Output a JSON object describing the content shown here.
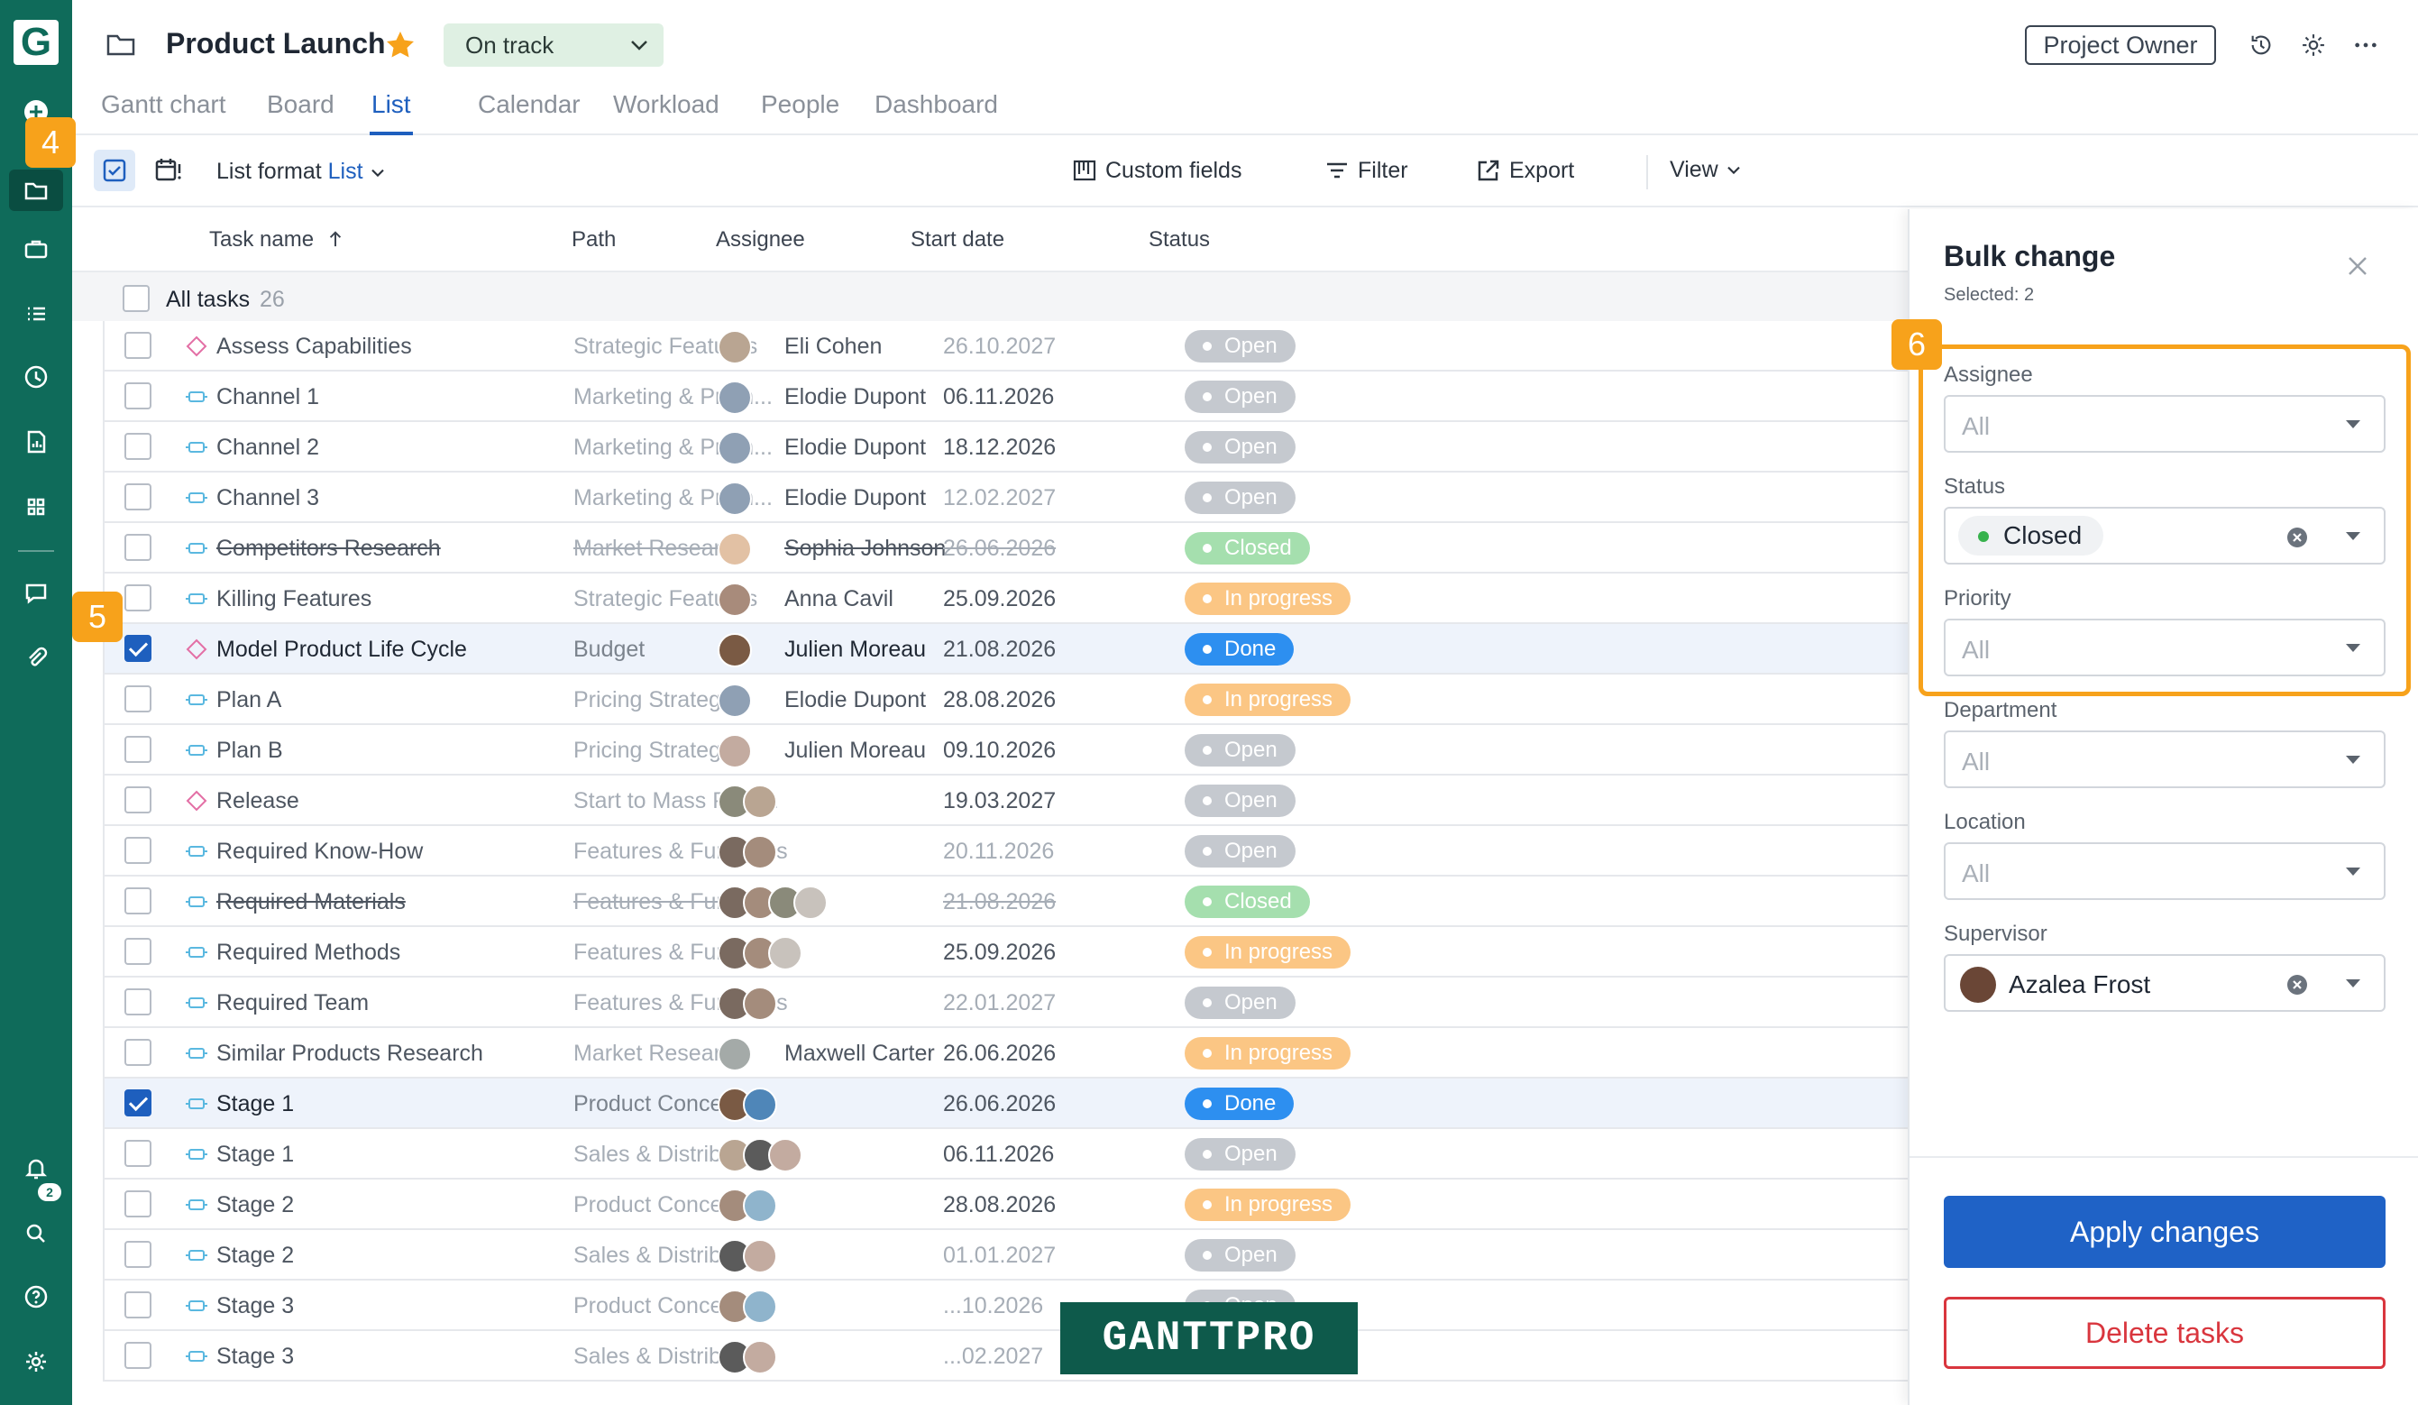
{
  "header": {
    "project_title": "Product Launch",
    "status": "On track",
    "role": "Project Owner",
    "tabs": [
      "Gantt chart",
      "Board",
      "List",
      "Calendar",
      "Workload",
      "People",
      "Dashboard"
    ],
    "active_tab": "List"
  },
  "toolbar": {
    "list_format_label": "List format",
    "list_format_value": "List",
    "custom_fields": "Custom fields",
    "filter": "Filter",
    "export": "Export",
    "view": "View"
  },
  "table": {
    "columns": [
      "Task name",
      "Path",
      "Assignee",
      "Start date",
      "Status"
    ],
    "all_tasks_label": "All tasks",
    "all_tasks_count": "26",
    "rows": [
      {
        "name": "Assess Capabilities",
        "icon": "milestone-icon",
        "path": "Strategic Features",
        "assignee": "Eli Cohen",
        "avatars": [
          "#b9a592"
        ],
        "date": "26.10.2027",
        "status": "Open",
        "checked": false,
        "strike": false
      },
      {
        "name": "Channel 1",
        "icon": "task-icon",
        "path": "Marketing & Prom...",
        "assignee": "Elodie Dupont",
        "avatars": [
          "#8fa0b4"
        ],
        "date": "06.11.2026",
        "status": "Open",
        "checked": false,
        "strike": false
      },
      {
        "name": "Channel 2",
        "icon": "task-icon",
        "path": "Marketing & Prom...",
        "assignee": "Elodie Dupont",
        "avatars": [
          "#8fa0b4"
        ],
        "date": "18.12.2026",
        "status": "Open",
        "checked": false,
        "strike": false
      },
      {
        "name": "Channel 3",
        "icon": "task-icon",
        "path": "Marketing & Prom...",
        "assignee": "Elodie Dupont",
        "avatars": [
          "#8fa0b4"
        ],
        "date": "12.02.2027",
        "status": "Open",
        "checked": false,
        "strike": false
      },
      {
        "name": "Competitors Research",
        "icon": "task-icon",
        "path": "Market Research",
        "assignee": "Sophia Johnson",
        "avatars": [
          "#e2c1a4"
        ],
        "date": "26.06.2026",
        "status": "Closed",
        "checked": false,
        "strike": true
      },
      {
        "name": "Killing Features",
        "icon": "task-icon",
        "path": "Strategic Features",
        "assignee": "Anna Cavil",
        "avatars": [
          "#a88b7b"
        ],
        "date": "25.09.2026",
        "status": "In progress",
        "checked": false,
        "strike": false
      },
      {
        "name": "Model Product Life Cycle",
        "icon": "milestone-icon",
        "path": "Budget",
        "assignee": "Julien Moreau",
        "avatars": [
          "#7a5a44"
        ],
        "date": "21.08.2026",
        "status": "Done",
        "checked": true,
        "strike": false
      },
      {
        "name": "Plan A",
        "icon": "task-icon",
        "path": "Pricing Strategy",
        "assignee": "Elodie Dupont",
        "avatars": [
          "#8fa0b4"
        ],
        "date": "28.08.2026",
        "status": "In progress",
        "checked": false,
        "strike": false
      },
      {
        "name": "Plan B",
        "icon": "task-icon",
        "path": "Pricing Strategy",
        "assignee": "Julien Moreau",
        "avatars": [
          "#c3aba0"
        ],
        "date": "09.10.2026",
        "status": "Open",
        "checked": false,
        "strike": false
      },
      {
        "name": "Release",
        "icon": "milestone-icon",
        "path": "Start to Mass Prod...",
        "assignee": "",
        "avatars": [
          "#8a8a7a",
          "#b9a592"
        ],
        "date": "19.03.2027",
        "status": "Open",
        "checked": false,
        "strike": false
      },
      {
        "name": "Required Know-How",
        "icon": "task-icon",
        "path": "Features & Functions",
        "assignee": "",
        "avatars": [
          "#7a6a60",
          "#a48c7c"
        ],
        "date": "20.11.2026",
        "status": "Open",
        "checked": false,
        "strike": false
      },
      {
        "name": "Required Materials",
        "icon": "task-icon",
        "path": "Features & Functions",
        "assignee": "",
        "avatars": [
          "#7a6a60",
          "#a48c7c",
          "#8a8a7a",
          "#c8c2bc"
        ],
        "date": "21.08.2026",
        "status": "Closed",
        "checked": false,
        "strike": true
      },
      {
        "name": "Required Methods",
        "icon": "task-icon",
        "path": "Features & Functions",
        "assignee": "",
        "avatars": [
          "#7a6a60",
          "#a48c7c",
          "#c8c2bc"
        ],
        "date": "25.09.2026",
        "status": "In progress",
        "checked": false,
        "strike": false
      },
      {
        "name": "Required Team",
        "icon": "task-icon",
        "path": "Features & Functions",
        "assignee": "",
        "avatars": [
          "#7a6a60",
          "#a48c7c"
        ],
        "date": "22.01.2027",
        "status": "Open",
        "checked": false,
        "strike": false
      },
      {
        "name": "Similar Products Research",
        "icon": "task-icon",
        "path": "Market Research",
        "assignee": "Maxwell Carter",
        "avatars": [
          "#a4aaa8"
        ],
        "date": "26.06.2026",
        "status": "In progress",
        "checked": false,
        "strike": false
      },
      {
        "name": "Stage 1",
        "icon": "task-icon",
        "path": "Product Concept",
        "assignee": "",
        "avatars": [
          "#7a5a44",
          "#4f86b8"
        ],
        "date": "26.06.2026",
        "status": "Done",
        "checked": true,
        "strike": false
      },
      {
        "name": "Stage 1",
        "icon": "task-icon",
        "path": "Sales & Distributio...",
        "assignee": "",
        "avatars": [
          "#b9a592",
          "#5b5b5b",
          "#c3aba0"
        ],
        "date": "06.11.2026",
        "status": "Open",
        "checked": false,
        "strike": false
      },
      {
        "name": "Stage 2",
        "icon": "task-icon",
        "path": "Product Concept",
        "assignee": "",
        "avatars": [
          "#a48c7c",
          "#8fb4cc"
        ],
        "date": "28.08.2026",
        "status": "In progress",
        "checked": false,
        "strike": false
      },
      {
        "name": "Stage 2",
        "icon": "task-icon",
        "path": "Sales & Distributio...",
        "assignee": "",
        "avatars": [
          "#5b5b5b",
          "#c3aba0"
        ],
        "date": "01.01.2027",
        "status": "Open",
        "checked": false,
        "strike": false
      },
      {
        "name": "Stage 3",
        "icon": "task-icon",
        "path": "Product Concept",
        "assignee": "",
        "avatars": [
          "#a48c7c",
          "#8fb4cc"
        ],
        "date": "...10.2026",
        "status": "Open",
        "checked": false,
        "strike": false
      },
      {
        "name": "Stage 3",
        "icon": "task-icon",
        "path": "Sales & Distributio...",
        "assignee": "",
        "avatars": [
          "#5b5b5b",
          "#c3aba0"
        ],
        "date": "...02.2027",
        "status": "Open",
        "checked": false,
        "strike": false
      }
    ]
  },
  "panel": {
    "title": "Bulk change",
    "subtitle": "Selected: 2",
    "fields": [
      {
        "label": "Assignee",
        "value": "All"
      },
      {
        "label": "Status",
        "value": "Closed"
      },
      {
        "label": "Priority",
        "value": "All"
      },
      {
        "label": "Department",
        "value": "All"
      },
      {
        "label": "Location",
        "value": "All"
      },
      {
        "label": "Supervisor",
        "value": "Azalea Frost"
      }
    ],
    "apply_label": "Apply changes",
    "delete_label": "Delete tasks"
  },
  "callouts": [
    "4",
    "5",
    "6"
  ],
  "rail": {
    "notification_count": "2"
  },
  "watermark": "GANTTPRO",
  "colors": {
    "rail": "#0f6b5a",
    "accent": "#1e5fbe",
    "callout": "#f7a21b",
    "status_open": "#c5c9cf",
    "status_closed": "#a5dfae",
    "status_in_progress": "#fbc684",
    "status_done": "#2d8ff0",
    "delete": "#d9363e"
  }
}
